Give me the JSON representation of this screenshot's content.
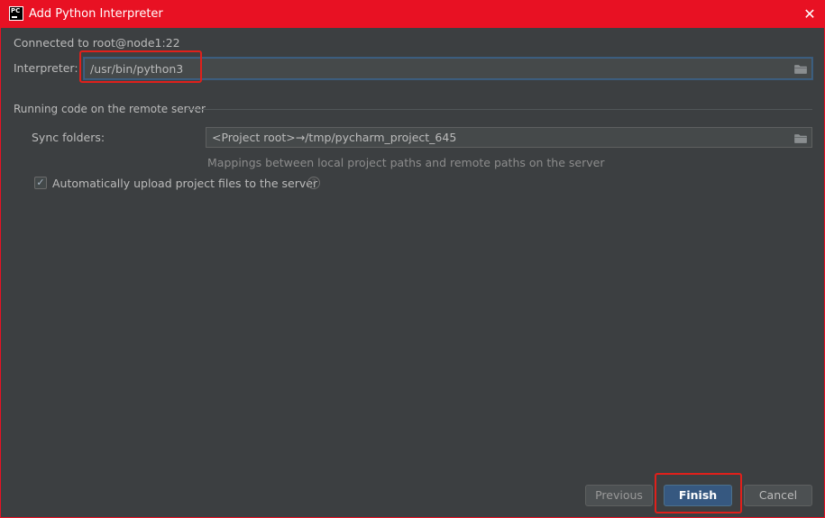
{
  "window": {
    "title": "Add Python Interpreter",
    "app_icon_text": "PC",
    "close_glyph": "✕",
    "accent_color": "#e81123"
  },
  "connection": {
    "status": "Connected to root@node1:22"
  },
  "interpreter": {
    "label": "Interpreter:",
    "value": "/usr/bin/python3",
    "browse_icon": "folder-icon"
  },
  "remote_section": {
    "title": "Running code on the remote server",
    "sync_label": "Sync folders:",
    "sync_value": "<Project root>→/tmp/pycharm_project_645",
    "sync_browse_icon": "folder-icon",
    "hint": "Mappings between local project paths and remote paths on the server",
    "auto_upload_label": "Automatically upload project files to the server",
    "auto_upload_checked": true,
    "help_glyph": "?"
  },
  "buttons": {
    "previous": "Previous",
    "finish": "Finish",
    "cancel": "Cancel"
  }
}
